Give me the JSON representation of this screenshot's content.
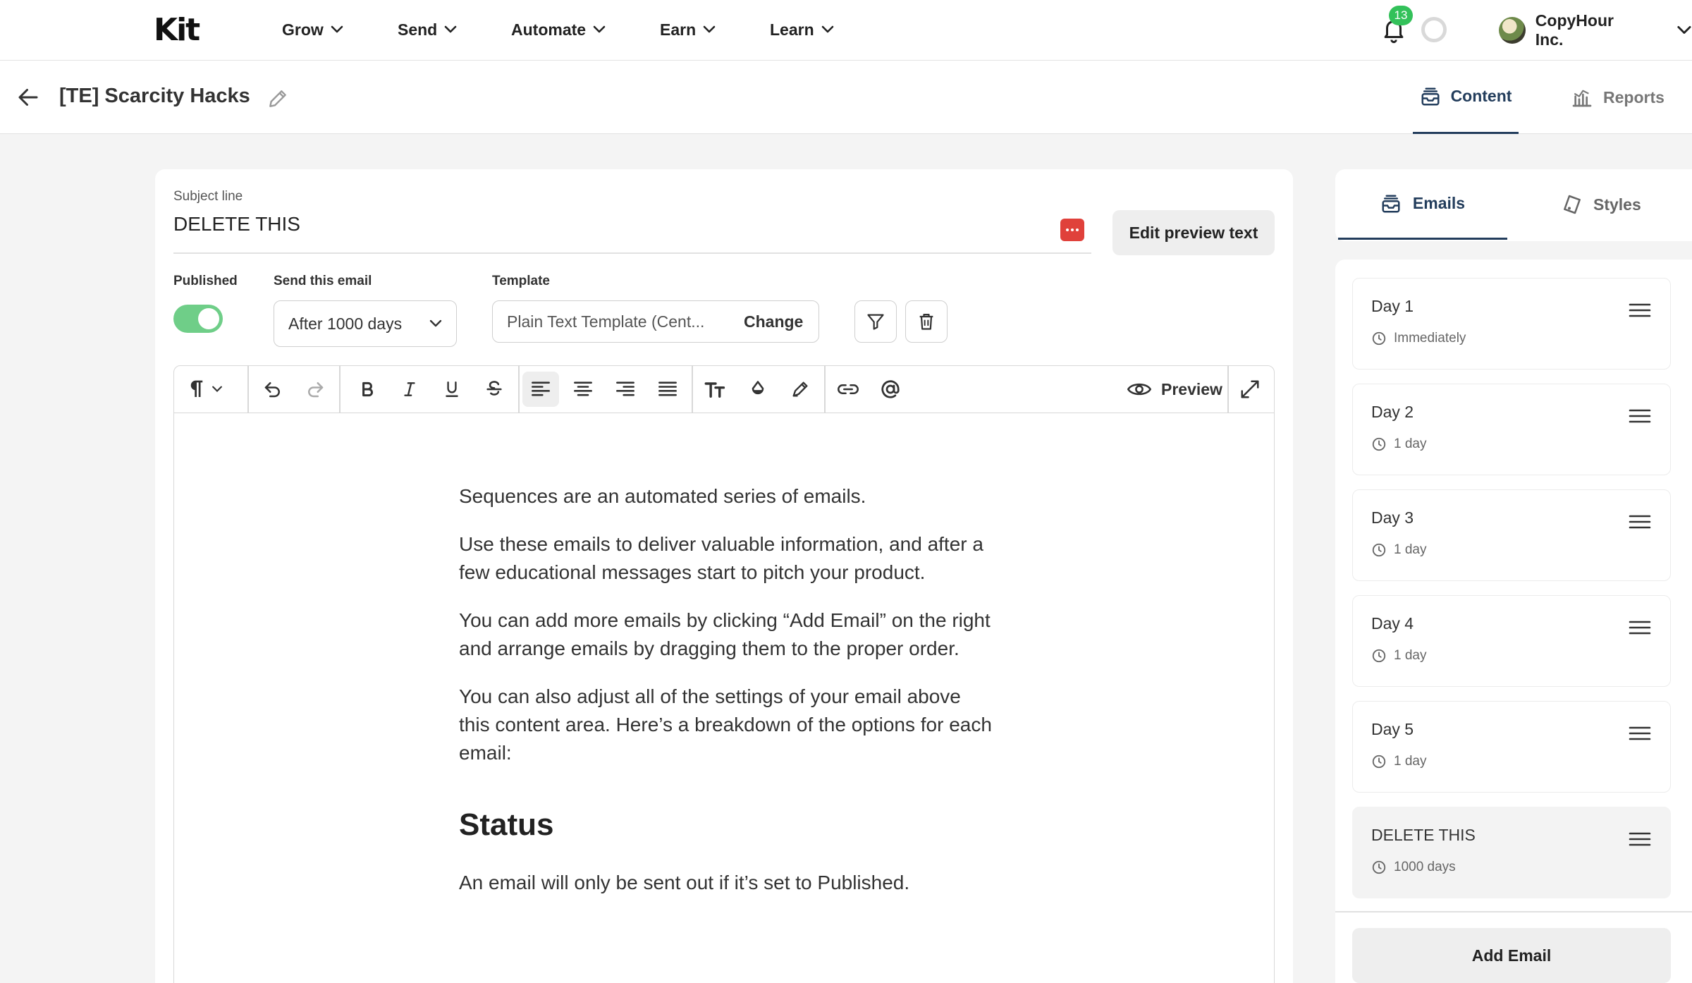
{
  "topnav": {
    "logo": "Kit",
    "items": [
      {
        "label": "Grow"
      },
      {
        "label": "Send"
      },
      {
        "label": "Automate"
      },
      {
        "label": "Earn"
      },
      {
        "label": "Learn"
      }
    ],
    "notification_count": "13",
    "account_name": "CopyHour Inc."
  },
  "header": {
    "title": "[TE] Scarcity Hacks",
    "tabs": {
      "content": "Content",
      "reports": "Reports"
    }
  },
  "editor": {
    "subject_label": "Subject line",
    "subject_value": "DELETE THIS",
    "edit_preview_label": "Edit preview text",
    "published_label": "Published",
    "published": true,
    "send_label": "Send this email",
    "send_value": "After 1000 days",
    "template_label": "Template",
    "template_value": "Plain Text Template (Cent...",
    "template_change": "Change",
    "preview_label": "Preview",
    "body": {
      "p1": "Sequences are an automated series of emails.",
      "p2": "Use these emails to deliver valuable information, and after a few educational messages start to pitch your product.",
      "p3": "You can add more emails by clicking “Add Email” on the right and arrange emails by dragging them to the proper order.",
      "p4": "You can also adjust all of the settings of your email above this content area. Here’s a breakdown of the options for each email:",
      "h_status": "Status",
      "p5": "An email will only be sent out if it’s set to Published."
    }
  },
  "sidebar": {
    "tabs": {
      "emails": "Emails",
      "styles": "Styles"
    },
    "emails": [
      {
        "title": "Day 1",
        "delay": "Immediately"
      },
      {
        "title": "Day 2",
        "delay": "1 day"
      },
      {
        "title": "Day 3",
        "delay": "1 day"
      },
      {
        "title": "Day 4",
        "delay": "1 day"
      },
      {
        "title": "Day 5",
        "delay": "1 day"
      },
      {
        "title": "DELETE THIS",
        "delay": "1000 days"
      }
    ],
    "add_email_label": "Add Email"
  },
  "colors": {
    "accent": "#233d5c",
    "toggle_on": "#6fce88",
    "badge": "#33c15a",
    "alert_icon": "#e0413b"
  }
}
